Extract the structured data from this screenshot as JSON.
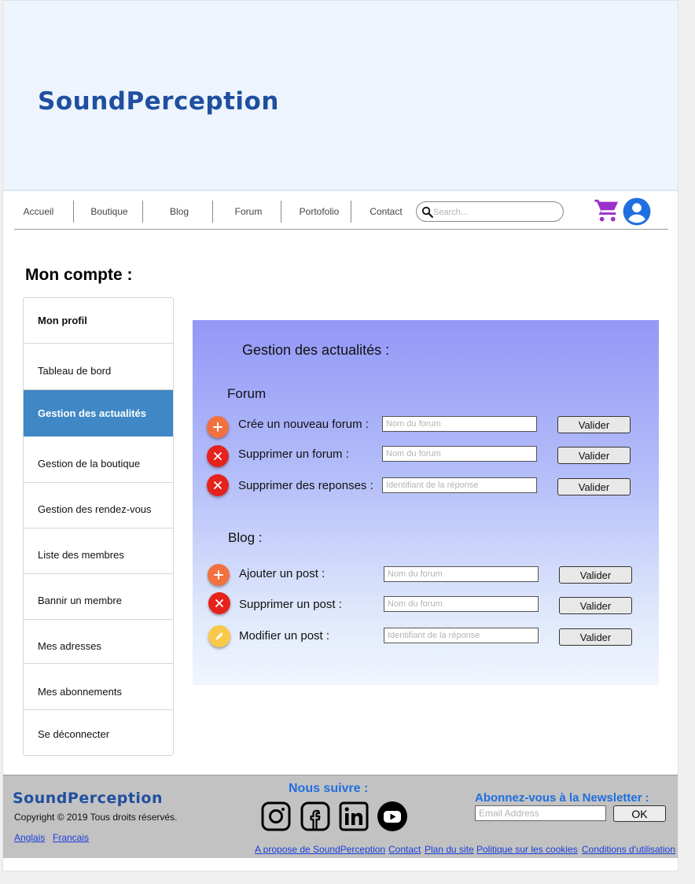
{
  "header": {
    "brand": "SoundPerception"
  },
  "nav": {
    "items": [
      "Accueil",
      "Boutique",
      "Blog",
      "Forum",
      "Portofolio",
      "Contact"
    ],
    "search_placeholder": "Search...",
    "cart_icon": "cart-icon",
    "user_icon": "user-icon",
    "accent_color": "#9b2fc9",
    "user_color": "#1f6fe0"
  },
  "account": {
    "title": "Mon compte :",
    "menu": [
      "Mon profil",
      "Tableau de bord",
      "Gestion des actualités",
      "Gestion de la boutique",
      "Gestion des rendez-vous",
      "Liste des membres",
      "Bannir un membre",
      "Mes adresses",
      "Mes abonnements",
      "Se déconnecter"
    ],
    "active_item": "Gestion des actualités"
  },
  "panel": {
    "title": "Gestion des actualités :",
    "forum": {
      "title": "Forum",
      "rows": [
        {
          "icon": "plus-icon",
          "label": "Crée un nouveau forum :",
          "placeholder": "Nom du forum",
          "button": "Valider"
        },
        {
          "icon": "close-icon",
          "label": "Supprimer un forum :",
          "placeholder": "Nom du forum",
          "button": "Valider"
        },
        {
          "icon": "close-icon",
          "label": "Supprimer des reponses :",
          "placeholder": "Identifiant de la réponse",
          "button": "Valider"
        }
      ]
    },
    "blog": {
      "title": "Blog :",
      "rows": [
        {
          "icon": "plus-icon",
          "label": "Ajouter un post :",
          "placeholder": "Nom du forum",
          "button": "Valider"
        },
        {
          "icon": "close-icon",
          "label": "Supprimer un post :",
          "placeholder": "Nom du forum",
          "button": "Valider"
        },
        {
          "icon": "pencil-icon",
          "label": "Modifier un post :",
          "placeholder": "Identifiant de la réponse",
          "button": "Valider"
        }
      ]
    }
  },
  "footer": {
    "brand": "SoundPerception",
    "copyright": "Copyright © 2019 Tous droits réservés.",
    "languages": [
      "Anglais",
      "Francais"
    ],
    "follow_title": "Nous suivre :",
    "social_icons": [
      "instagram-icon",
      "facebook-icon",
      "linkedin-icon",
      "youtube-icon"
    ],
    "newsletter_title": "Abonnez-vous à la Newsletter :",
    "email_placeholder": "Email Address",
    "ok_label": "OK",
    "links": [
      "A propose de SoundPerception",
      "Contact",
      "Plan du site",
      "Politique sur les cookies",
      "Conditions d'utilisation"
    ]
  }
}
